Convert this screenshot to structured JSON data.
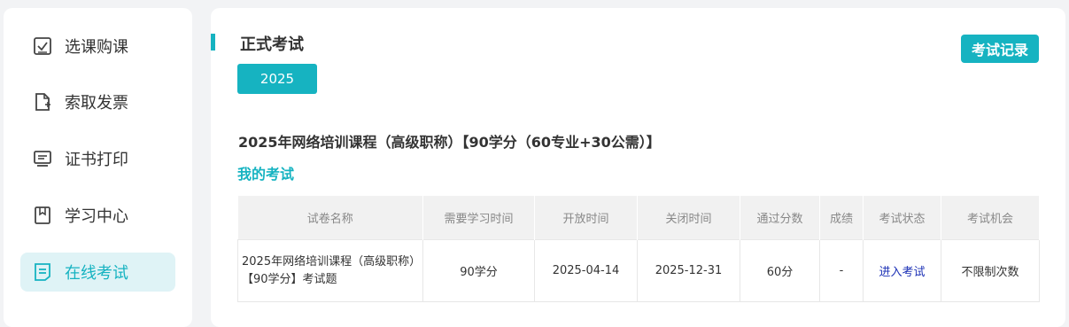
{
  "sidebar": {
    "items": [
      {
        "label": "选课购课",
        "icon": "checkbox-icon"
      },
      {
        "label": "索取发票",
        "icon": "document-add-icon"
      },
      {
        "label": "证书打印",
        "icon": "monitor-icon"
      },
      {
        "label": "学习中心",
        "icon": "bookmark-icon"
      },
      {
        "label": "在线考试",
        "icon": "document-list-icon",
        "active": true
      }
    ]
  },
  "main": {
    "title": "正式考试",
    "record_button": "考试记录",
    "year_tab": "2025",
    "course_title": "2025年网络培训课程（高级职称）【90学分（60专业+30公需）】",
    "my_exam_label": "我的考试",
    "table": {
      "headers": [
        "试卷名称",
        "需要学习时间",
        "开放时间",
        "关闭时间",
        "通过分数",
        "成绩",
        "考试状态",
        "考试机会"
      ],
      "rows": [
        {
          "name": "2025年网络培训课程（高级职称）【90学分】考试题",
          "study_time": "90学分",
          "open_time": "2025-04-14",
          "close_time": "2025-12-31",
          "pass_score": "60分",
          "score": "-",
          "status": "进入考试",
          "chances": "不限制次数"
        }
      ]
    }
  },
  "colors": {
    "accent": "#16b3c1",
    "link": "#1a2fb5",
    "active_bg": "#dff3f6"
  }
}
